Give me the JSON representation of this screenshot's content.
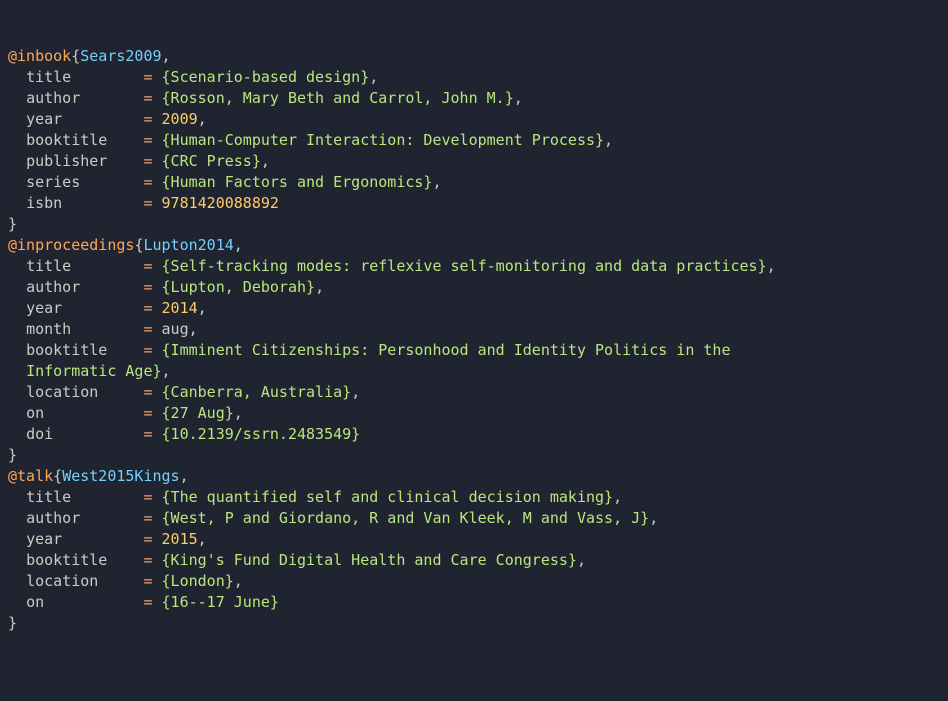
{
  "entries": [
    {
      "type": "@inbook",
      "key": "Sears2009",
      "fields": [
        {
          "name": "title",
          "kind": "braced",
          "value": "Scenario-based design",
          "term": ","
        },
        {
          "name": "author",
          "kind": "braced",
          "value": "Rosson, Mary Beth and Carrol, John M.",
          "term": ","
        },
        {
          "name": "year",
          "kind": "number",
          "value": "2009",
          "term": ","
        },
        {
          "name": "booktitle",
          "kind": "braced",
          "value": "Human-Computer Interaction: Development Process",
          "term": ","
        },
        {
          "name": "publisher",
          "kind": "braced",
          "value": "CRC Press",
          "term": ","
        },
        {
          "name": "series",
          "kind": "braced",
          "value": "Human Factors and Ergonomics",
          "term": ","
        },
        {
          "name": "isbn",
          "kind": "number",
          "value": "9781420088892",
          "term": ""
        }
      ]
    },
    {
      "type": "@inproceedings",
      "key": "Lupton2014",
      "fields": [
        {
          "name": "title",
          "kind": "braced",
          "value": "Self-tracking modes: reflexive self-monitoring and data practices",
          "term": ","
        },
        {
          "name": "author",
          "kind": "braced",
          "value": "Lupton, Deborah",
          "term": ","
        },
        {
          "name": "year",
          "kind": "number",
          "value": "2014",
          "term": ","
        },
        {
          "name": "month",
          "kind": "bare",
          "value": "aug",
          "term": ","
        },
        {
          "name": "booktitle",
          "kind": "braced-wrap",
          "value_line1": "Imminent Citizenships: Personhood and Identity Politics in the",
          "value_line2": "Informatic Age",
          "term": ","
        },
        {
          "name": "location",
          "kind": "braced",
          "value": "Canberra, Australia",
          "term": ","
        },
        {
          "name": "on",
          "kind": "braced",
          "value": "27 Aug",
          "term": ","
        },
        {
          "name": "doi",
          "kind": "braced",
          "value": "10.2139/ssrn.2483549",
          "term": ""
        }
      ]
    },
    {
      "type": "@talk",
      "key": "West2015Kings",
      "fields": [
        {
          "name": "title",
          "kind": "braced",
          "value": "The quantified self and clinical decision making",
          "term": ","
        },
        {
          "name": "author",
          "kind": "braced",
          "value": "West, P and Giordano, R and Van Kleek, M and Vass, J",
          "term": ","
        },
        {
          "name": "year",
          "kind": "number",
          "value": "2015",
          "term": ","
        },
        {
          "name": "booktitle",
          "kind": "braced",
          "value": "King's Fund Digital Health and Care Congress",
          "term": ","
        },
        {
          "name": "location",
          "kind": "braced",
          "value": "London",
          "term": ","
        },
        {
          "name": "on",
          "kind": "braced",
          "value": "16--17 June",
          "term": ""
        }
      ]
    }
  ],
  "layout": {
    "field_col_width": 12,
    "indent": "  ",
    "cont_indent": "  "
  },
  "chart_data": {
    "type": "table",
    "title": "BibTeX entries",
    "series": [
      {
        "name": "Sears2009",
        "entry_type": "inbook",
        "values": {
          "title": "Scenario-based design",
          "author": "Rosson, Mary Beth and Carrol, John M.",
          "year": 2009,
          "booktitle": "Human-Computer Interaction: Development Process",
          "publisher": "CRC Press",
          "series": "Human Factors and Ergonomics",
          "isbn": "9781420088892"
        }
      },
      {
        "name": "Lupton2014",
        "entry_type": "inproceedings",
        "values": {
          "title": "Self-tracking modes: reflexive self-monitoring and data practices",
          "author": "Lupton, Deborah",
          "year": 2014,
          "month": "aug",
          "booktitle": "Imminent Citizenships: Personhood and Identity Politics in the Informatic Age",
          "location": "Canberra, Australia",
          "on": "27 Aug",
          "doi": "10.2139/ssrn.2483549"
        }
      },
      {
        "name": "West2015Kings",
        "entry_type": "talk",
        "values": {
          "title": "The quantified self and clinical decision making",
          "author": "West, P and Giordano, R and Van Kleek, M and Vass, J",
          "year": 2015,
          "booktitle": "King's Fund Digital Health and Care Congress",
          "location": "London",
          "on": "16--17 June"
        }
      }
    ]
  },
  "colors": {
    "background": "#1f2430",
    "default": "#cbccc6",
    "entry_type": "#ffa759",
    "cite_key": "#73d0ff",
    "string": "#bae67e",
    "number": "#ffcc66",
    "equals": "#f29e74"
  }
}
